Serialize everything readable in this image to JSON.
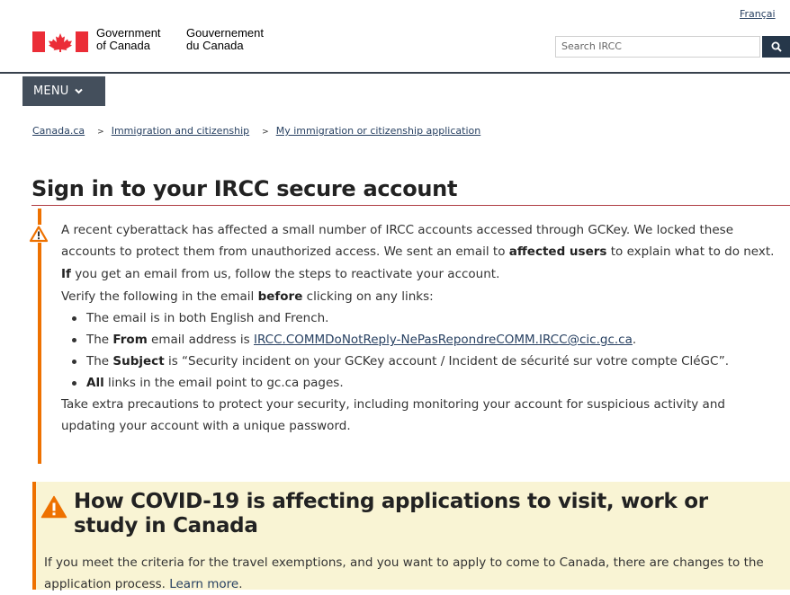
{
  "header": {
    "language_link": "Françai",
    "gov_en_line1": "Government",
    "gov_en_line2": "of Canada",
    "gov_fr_line1": "Gouvernement",
    "gov_fr_line2": "du Canada",
    "search_placeholder": "Search IRCC",
    "search_icon": "search-icon",
    "colors": {
      "flag_red": "#eb2d37",
      "search_button": "#26374a",
      "menu": "#444f5c"
    }
  },
  "menu": {
    "label": "MENU"
  },
  "breadcrumb": {
    "items": [
      "Canada.ca",
      "Immigration and citizenship",
      "My immigration or citizenship application"
    ],
    "separator": ">"
  },
  "page": {
    "title": "Sign in to your IRCC secure account"
  },
  "warning": {
    "icon": "warning-icon",
    "accent": "#ee7100",
    "p1_line1": "A recent cyberattack has affected a small number of IRCC accounts accessed through GCKey. We locked these",
    "p1_line2_pre": "accounts to protect them from unauthorized access. We sent an email to ",
    "p1_line2_bold": "affected users",
    "p1_line2_post": " to explain what to do next.",
    "p2_bold": "If",
    "p2_rest": " you get an email from us, follow the steps to reactivate your account.",
    "p3_pre": "Verify the following in the email ",
    "p3_bold": "before",
    "p3_post": " clicking on any links:",
    "bullet1": "The email is in both English and French.",
    "bullet2_pre": "The ",
    "bullet2_bold": "From",
    "bullet2_mid": " email address is ",
    "bullet2_link": "IRCC.COMMDoNotReply-NePasRepondreCOMM.IRCC@cic.gc.ca",
    "bullet2_post": ".",
    "bullet3_pre": "The ",
    "bullet3_bold": "Subject",
    "bullet3_post": " is “Security incident on your GCKey account / Incident de sécurité sur votre compte CléGC”.",
    "bullet4_bold": "All",
    "bullet4_post": " links in the email point to gc.ca pages.",
    "p4_line1": "Take extra precautions to protect your security, including monitoring your account for suspicious activity and",
    "p4_line2": "updating your account with a unique password."
  },
  "covid": {
    "icon": "warning-icon",
    "background": "#f9f4d4",
    "title": "How COVID-19 is affecting applications to visit, work or study in Canada",
    "text": "If you meet the criteria for the travel exemptions, and you want to apply to come to Canada, there are changes to the application process. ",
    "link": "Learn more"
  }
}
